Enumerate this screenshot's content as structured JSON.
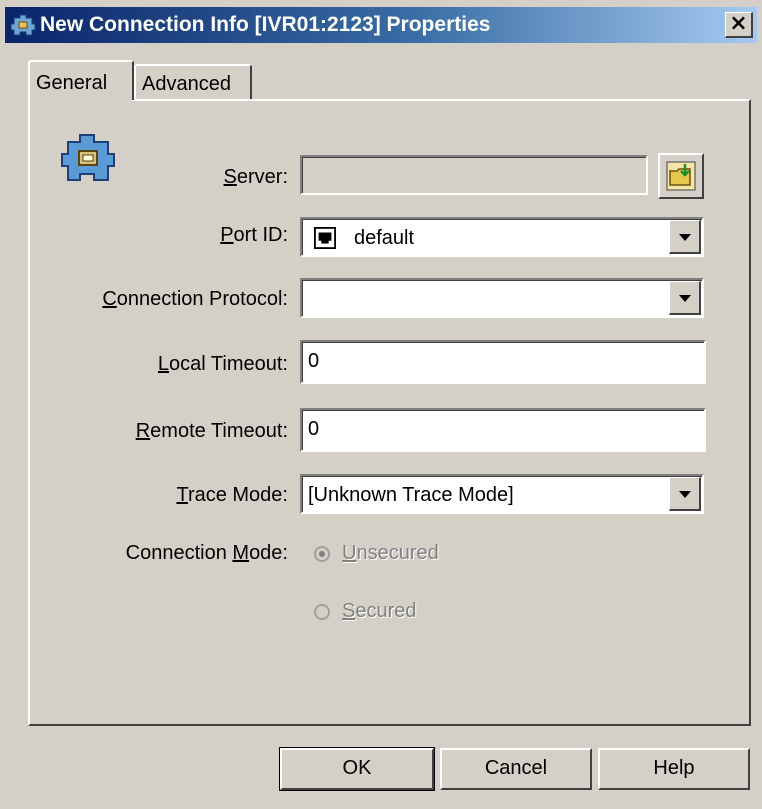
{
  "window": {
    "title": "New Connection Info [IVR01:2123] Properties",
    "close_label": "×"
  },
  "tabs": [
    {
      "label": "General",
      "active": true
    },
    {
      "label": "Advanced",
      "active": false
    }
  ],
  "form": {
    "server": {
      "label_prefix": "",
      "label_hotkey": "S",
      "label_rest": "erver:",
      "value": ""
    },
    "port_id": {
      "label_hotkey": "P",
      "label_rest": "ort ID:",
      "value": "default"
    },
    "connection_protocol": {
      "label_hotkey": "C",
      "label_rest": "onnection Protocol:",
      "value": ""
    },
    "local_timeout": {
      "label_hotkey": "L",
      "label_rest": "ocal Timeout:",
      "value": "0"
    },
    "remote_timeout": {
      "label_hotkey": "R",
      "label_rest": "emote Timeout:",
      "value": "0"
    },
    "trace_mode": {
      "label_hotkey": "T",
      "label_rest": "race Mode:",
      "value": "[Unknown Trace Mode]"
    },
    "connection_mode": {
      "label_prefix": "Connection ",
      "label_hotkey": "M",
      "label_rest": "ode:",
      "options": [
        {
          "hotkey": "U",
          "rest": "nsecured",
          "checked": true
        },
        {
          "hotkey": "S",
          "rest": "ecured",
          "checked": false
        }
      ]
    }
  },
  "buttons": {
    "ok": "OK",
    "cancel": "Cancel",
    "help": "Help"
  },
  "colors": {
    "face": "#d4d0c8",
    "title_start": "#0a246a",
    "title_end": "#a6caf0"
  }
}
